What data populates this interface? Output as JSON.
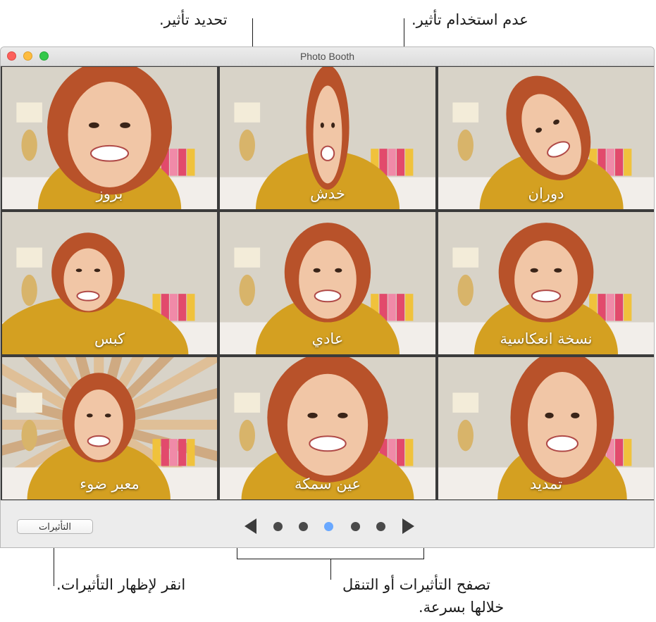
{
  "annotations": {
    "select_effect": "تحديد تأثير.",
    "no_effect": "عدم استخدام تأثير.",
    "click_show_effects": "انقر لإظهار التأثيرات.",
    "browse_line1": "تصفح التأثيرات أو التنقل",
    "browse_line2": "خلالها بسرعة."
  },
  "window": {
    "title": "Photo Booth"
  },
  "effects": [
    {
      "label": "دوران",
      "icon": "twirl-effect-photo"
    },
    {
      "label": "خدش",
      "icon": "squeeze-effect-photo",
      "selected": true
    },
    {
      "label": "بروز",
      "icon": "bulge-effect-photo"
    },
    {
      "label": "نسخة انعكاسية",
      "icon": "mirror-effect-photo"
    },
    {
      "label": "عادي",
      "icon": "normal-photo"
    },
    {
      "label": "كبس",
      "icon": "dent-effect-photo"
    },
    {
      "label": "تمديد",
      "icon": "stretch-effect-photo"
    },
    {
      "label": "عين سمكة",
      "icon": "fisheye-effect-photo"
    },
    {
      "label": "معبر ضوء",
      "icon": "light-tunnel-effect-photo"
    }
  ],
  "bottom": {
    "effects_button": "التأثيرات",
    "page_count": 5,
    "active_page": 3
  },
  "colors": {
    "sweater": "#d4a021",
    "hair": "#b8522a",
    "skin": "#f1c6a6",
    "wall": "#d8d3c8",
    "active_dot": "#69a8ff"
  }
}
